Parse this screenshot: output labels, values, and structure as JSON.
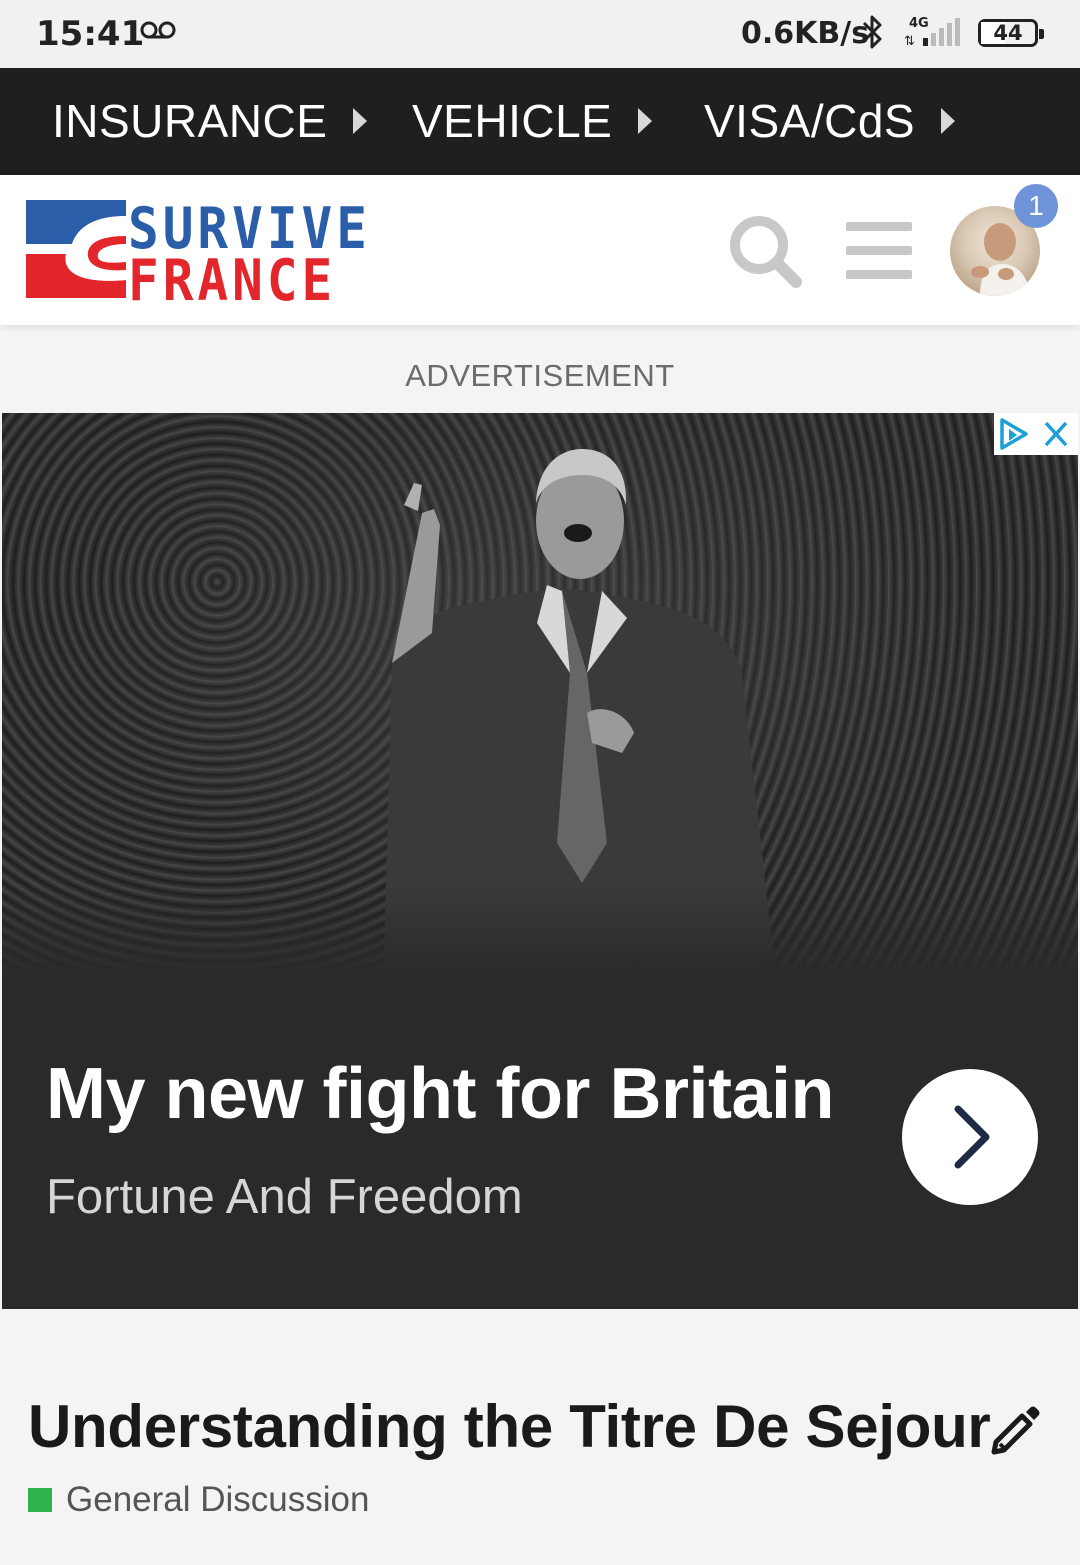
{
  "status_bar": {
    "time": "15:41",
    "network_speed": "0.6KB/s",
    "network_type": "4G",
    "battery_level": "44",
    "icons": [
      "voicemail-icon",
      "bluetooth-icon",
      "signal-icon",
      "battery-icon"
    ]
  },
  "top_nav": {
    "items": [
      {
        "label": "INSURANCE"
      },
      {
        "label": "VEHICLE"
      },
      {
        "label": "VISA/CdS"
      }
    ]
  },
  "header": {
    "logo_line1": "SURVIVE",
    "logo_line2": "FRANCE",
    "notification_count": "1",
    "colors": {
      "logo_blue": "#2a5ea8",
      "logo_red": "#e3262b",
      "badge": "#6f93d8"
    }
  },
  "advertisement": {
    "label": "ADVERTISEMENT",
    "title": "My new fight for Britain",
    "sponsor": "Fortune And Freedom"
  },
  "topic": {
    "title": "Understanding the Titre De Sejour",
    "category": "General Discussion",
    "category_color": "#2db34a"
  }
}
